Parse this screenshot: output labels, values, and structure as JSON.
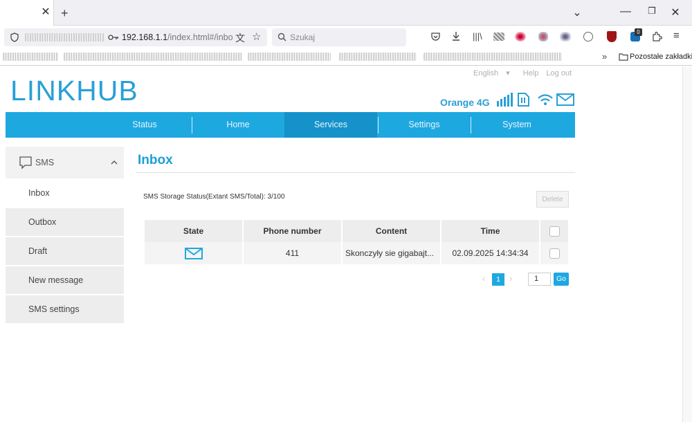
{
  "browser": {
    "url": "192.168.1.1",
    "url_path": "/index.html#/inbo",
    "search_placeholder": "Szukaj",
    "other_bookmarks": "Pozostałe zakładki",
    "extension_badge": "0"
  },
  "header": {
    "logo_bold": "LINK",
    "logo_light": "HUB",
    "language": "English",
    "help": "Help",
    "logout": "Log out",
    "carrier": "Orange 4G"
  },
  "nav": {
    "items": [
      "Status",
      "Home",
      "Services",
      "Settings",
      "System"
    ],
    "active": "Services"
  },
  "sidebar": {
    "section": "SMS",
    "items": [
      "Inbox",
      "Outbox",
      "Draft",
      "New message",
      "SMS settings"
    ],
    "active": "Inbox"
  },
  "main": {
    "title": "Inbox",
    "storage_status": "SMS Storage Status(Extant SMS/Total): 3/100",
    "delete_label": "Delete",
    "table": {
      "headers": [
        "State",
        "Phone number",
        "Content",
        "Time"
      ],
      "rows": [
        {
          "state": "unread-envelope-icon",
          "phone": "411",
          "content": "Skonczyły sie gigabajt...",
          "time": "02.09.2025 14:34:34"
        }
      ]
    },
    "pager": {
      "current_page": "1",
      "page_input": "1",
      "go_label": "Go"
    }
  },
  "colors": {
    "accent": "#1ea8e0",
    "title": "#1c9fd4"
  }
}
